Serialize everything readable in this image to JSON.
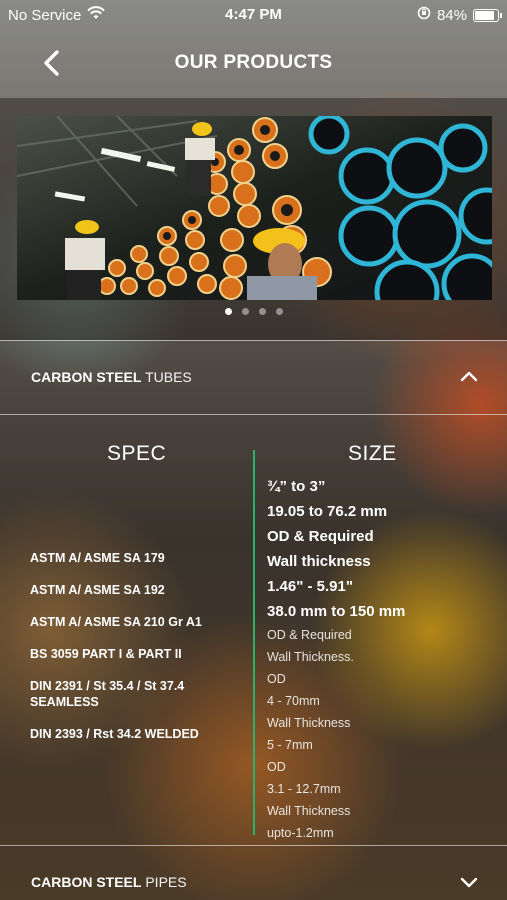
{
  "status": {
    "carrier": "No Service",
    "time": "4:47 PM",
    "battery": "84%"
  },
  "nav": {
    "title": "OUR PRODUCTS"
  },
  "carousel": {
    "page_count": 4,
    "active_index": 0
  },
  "sections": [
    {
      "bold": "CARBON STEEL",
      "light": "TUBES",
      "expanded": true
    },
    {
      "bold": "CARBON STEEL",
      "light": "PIPES",
      "expanded": false
    }
  ],
  "table": {
    "spec_header": "SPEC",
    "size_header": "SIZE",
    "specs": [
      "ASTM A/ ASME SA 179",
      "ASTM A/ ASME SA 192",
      "ASTM A/ ASME SA 210 Gr A1",
      "BS 3059 PART I & PART II",
      "DIN 2391 / St 35.4 / St 37.4 SEAMLESS",
      "DIN 2393 / Rst 34.2 WELDED"
    ],
    "sizes_bold": [
      "¾” to 3”",
      "19.05 to 76.2 mm",
      "OD & Required",
      "Wall thickness",
      "1.46\" - 5.91\"",
      "38.0 mm to 150 mm"
    ],
    "sizes_light": [
      "OD & Required",
      "Wall Thickness.",
      "OD",
      "4 - 70mm",
      "Wall Thickness",
      "5 - 7mm",
      "OD",
      "3.1 - 12.7mm",
      "Wall Thickness",
      "upto-1.2mm"
    ]
  },
  "colors": {
    "accent_line": "#27b36a",
    "pipe_orange": "#e07a1e",
    "pipe_blue": "#2fb6d6"
  }
}
